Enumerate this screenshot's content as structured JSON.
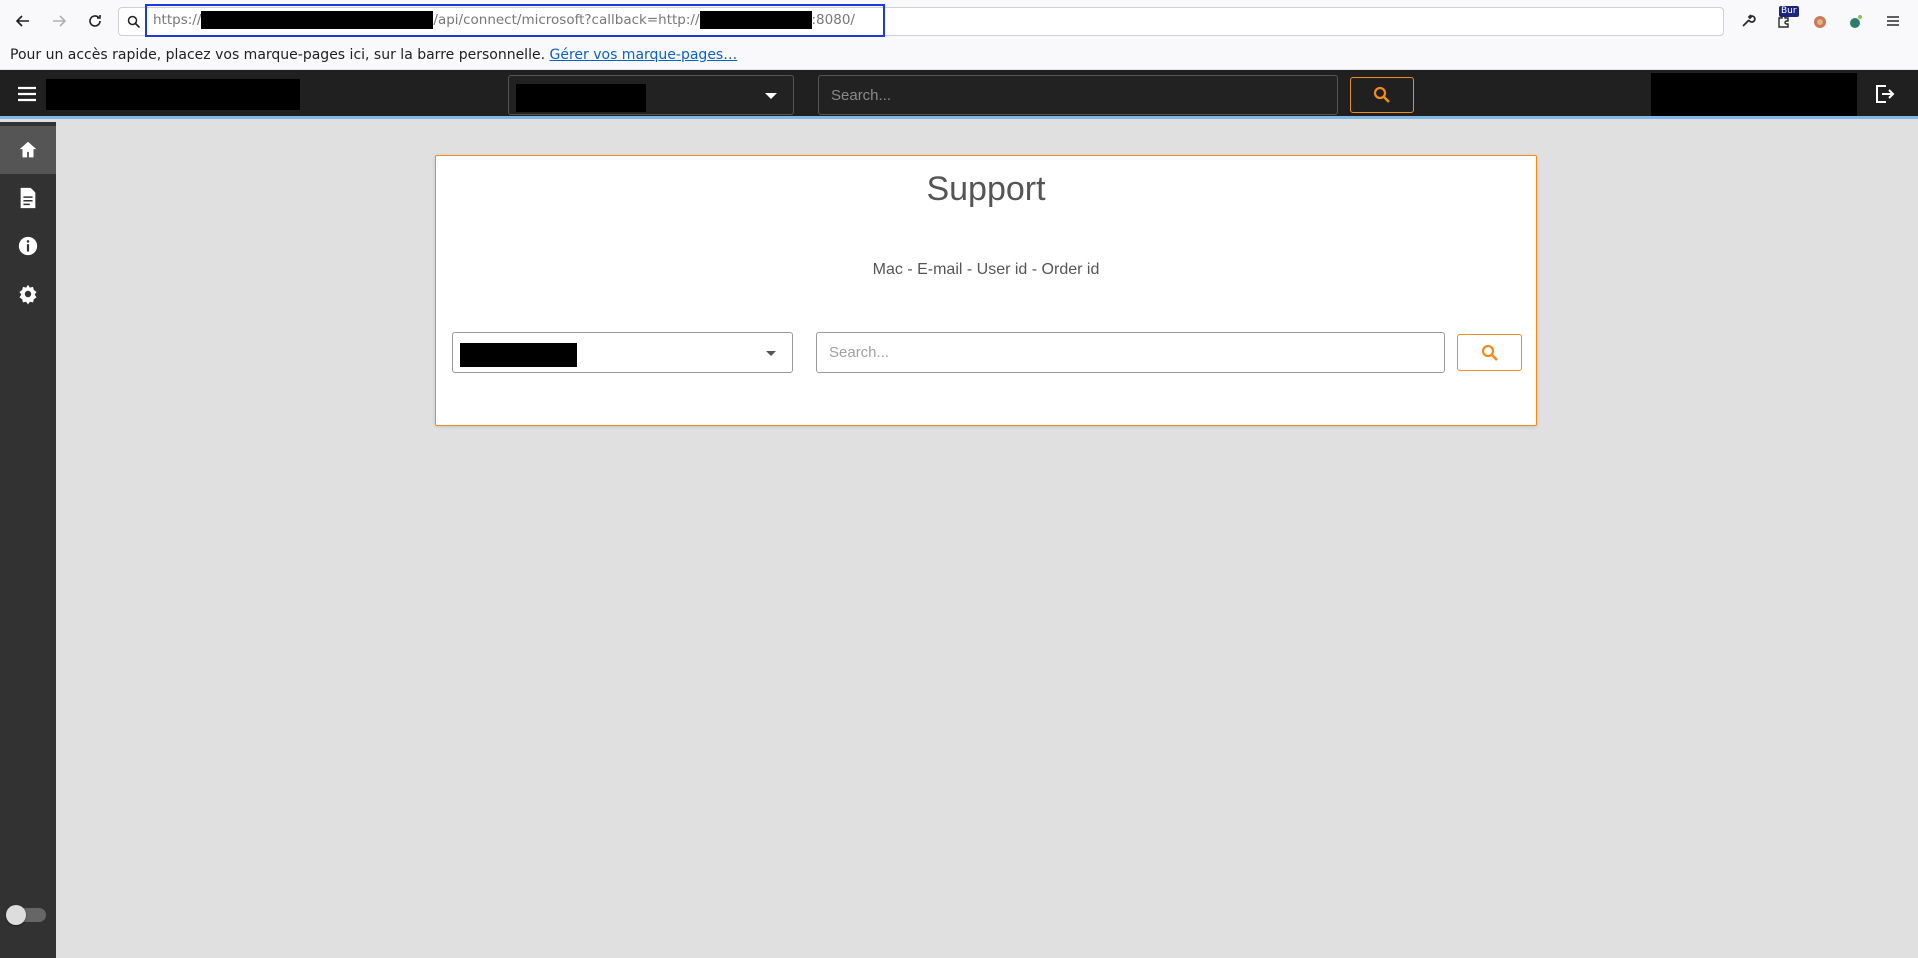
{
  "browser": {
    "url": {
      "scheme": "https://",
      "path": "/api/connect/microsoft?callback=http://",
      "port_path": ":8080/"
    },
    "extension_badge": "Bur",
    "bookmarks_bar": {
      "message": "Pour un accès rapide, placez vos marque-pages ici, sur la barre personnelle.",
      "link": "Gérer vos marque-pages…"
    }
  },
  "header": {
    "search_placeholder": "Search...",
    "accent_color": "#f08c1e"
  },
  "sidebar": {
    "items": [
      {
        "icon": "home-icon",
        "active": true
      },
      {
        "icon": "document-icon",
        "active": false
      },
      {
        "icon": "info-icon",
        "active": false
      },
      {
        "icon": "gear-icon",
        "active": false
      }
    ],
    "toggle_on": false
  },
  "card": {
    "title": "Support",
    "subtitle": "Mac - E-mail - User id - Order id",
    "search_placeholder": "Search..."
  }
}
